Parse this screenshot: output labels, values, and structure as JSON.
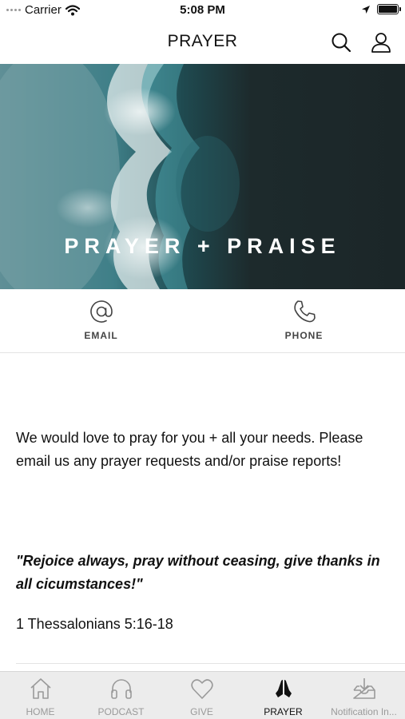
{
  "status_bar": {
    "carrier": "Carrier",
    "time": "5:08 PM",
    "icons": [
      "signal-dots-icon",
      "wifi-icon",
      "location-arrow-icon",
      "battery-icon"
    ]
  },
  "header": {
    "title": "PRAYER",
    "icons": [
      "search-icon",
      "profile-icon"
    ]
  },
  "hero": {
    "title": "PRAYER + PRAISE",
    "colors": {
      "dark": "#1d2a2c",
      "wave": "#3f7f88",
      "foam": "#dfe9ea"
    }
  },
  "contacts": [
    {
      "label": "EMAIL",
      "icon": "at-sign-icon"
    },
    {
      "label": "PHONE",
      "icon": "phone-icon"
    }
  ],
  "content": {
    "paragraph": "We would love to pray for you + all your needs. Please email us any prayer requests and/or praise reports!",
    "quote": "\"Rejoice always, pray without ceasing, give thanks in all cicumstances!\"",
    "reference": "1 Thessalonians 5:16-18"
  },
  "tabbar": {
    "tabs": [
      {
        "label": "HOME",
        "icon": "home-icon"
      },
      {
        "label": "PODCAST",
        "icon": "headphones-icon"
      },
      {
        "label": "GIVE",
        "icon": "heart-icon"
      },
      {
        "label": "PRAYER",
        "icon": "praying-hands-icon",
        "active": true
      },
      {
        "label": "Notification In...",
        "icon": "inbox-download-icon"
      }
    ]
  }
}
